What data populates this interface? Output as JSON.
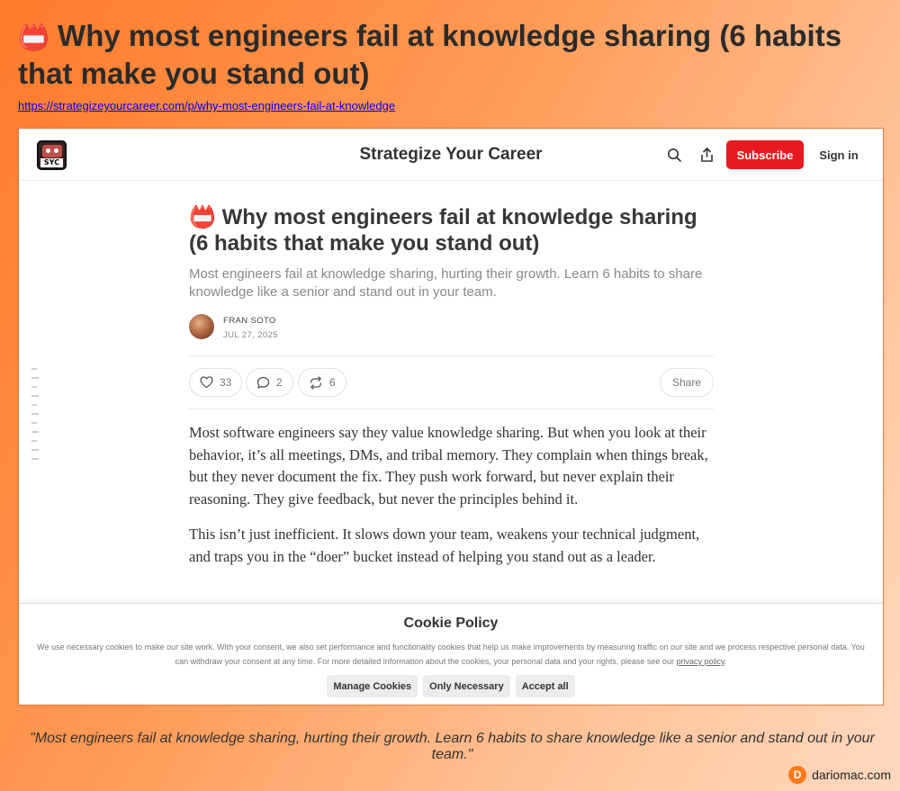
{
  "page": {
    "title_emoji": "📛",
    "title": "Why most engineers fail at knowledge sharing (6 habits that make you stand out)",
    "url": "https://strategizeyourcareer.com/p/why-most-engineers-fail-at-knowledge",
    "quote": "\"Most engineers fail at knowledge sharing, hurting their growth. Learn 6 habits to share knowledge like a senior and stand out in your team.\"",
    "credit_initial": "D",
    "credit": "dariomac.com"
  },
  "site": {
    "logo_text": "SYC",
    "name": "Strategize Your Career",
    "subscribe_label": "Subscribe",
    "signin_label": "Sign in",
    "search_icon": "search-icon",
    "share_icon": "share-icon"
  },
  "post": {
    "title_emoji": "📛",
    "title": "Why most engineers fail at knowledge sharing (6 habits that make you stand out)",
    "subtitle": "Most engineers fail at knowledge sharing, hurting their growth. Learn 6 habits to share knowledge like a senior and stand out in your team.",
    "author": "FRAN SOTO",
    "date": "JUL 27, 2025",
    "likes": "33",
    "comments": "2",
    "restacks": "6",
    "share_label": "Share",
    "paragraphs": [
      "Most software engineers say they value knowledge sharing. But when you look at their behavior, it’s all meetings, DMs, and tribal memory. They complain when things break, but they never document the fix. They push work forward, but never explain their reasoning. They give feedback, but never the principles behind it.",
      "This isn’t just inefficient. It slows down your team, weakens your technical judgment, and traps you in the “doer” bucket instead of helping you stand out as a leader."
    ]
  },
  "cookie": {
    "title": "Cookie Policy",
    "text": "We use necessary cookies to make our site work. With your consent, we also set performance and functionality cookies that help us make improvements by measuring traffic on our site and we process respective personal data. You can withdraw your consent at any time. For more detailed information about the cookies, your personal data and your rights, please see our",
    "privacy_link": "privacy policy",
    "text_end": ".",
    "manage_label": "Manage Cookies",
    "necessary_label": "Only Necessary",
    "accept_label": "Accept all"
  },
  "colors": {
    "accent": "#e8191f",
    "background_orange": "#ff7a2a",
    "link": "#0000ee"
  }
}
